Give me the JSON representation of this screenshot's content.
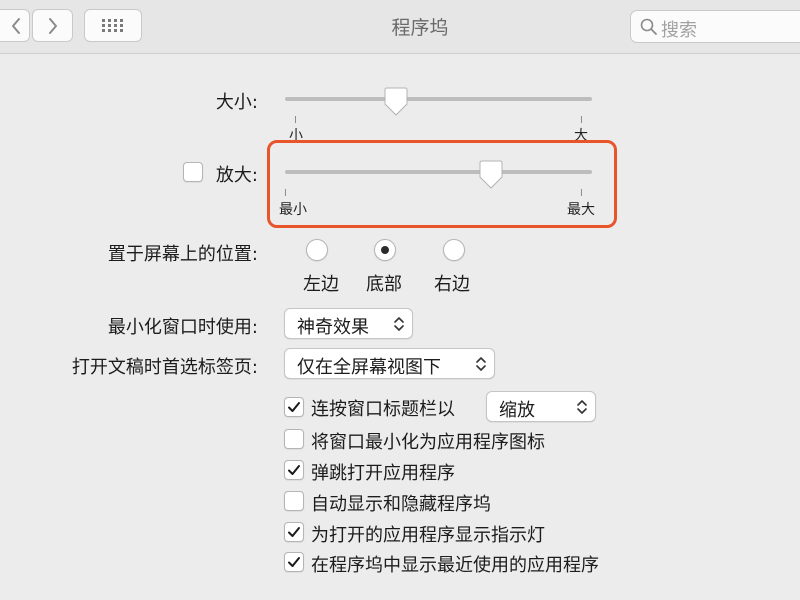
{
  "window": {
    "title": "程序坞"
  },
  "search": {
    "placeholder": "搜索"
  },
  "size": {
    "label": "大小:",
    "min_label": "小",
    "max_label": "大",
    "value_fraction": 0.36
  },
  "magnification": {
    "label": "放大:",
    "checked": false,
    "min_label": "最小",
    "max_label": "最大",
    "value_fraction": 0.67
  },
  "position": {
    "label": "置于屏幕上的位置:",
    "options": [
      "左边",
      "底部",
      "右边"
    ],
    "selected": "底部"
  },
  "minimize": {
    "label": "最小化窗口时使用:",
    "value": "神奇效果"
  },
  "tabs": {
    "label": "打开文稿时首选标签页:",
    "value": "仅在全屏幕视图下"
  },
  "options": [
    {
      "label": "连按窗口标题栏以",
      "checked": true
    },
    {
      "label": "将窗口最小化为应用程序图标",
      "checked": false
    },
    {
      "label": "弹跳打开应用程序",
      "checked": true
    },
    {
      "label": "自动显示和隐藏程序坞",
      "checked": false
    },
    {
      "label": "为打开的应用程序显示指示灯",
      "checked": true
    },
    {
      "label": "在程序坞中显示最近使用的应用程序",
      "checked": true
    }
  ],
  "double_click_action": {
    "value": "缩放"
  },
  "colors": {
    "highlight": "#e8552b",
    "track": "#bdbdbd"
  }
}
